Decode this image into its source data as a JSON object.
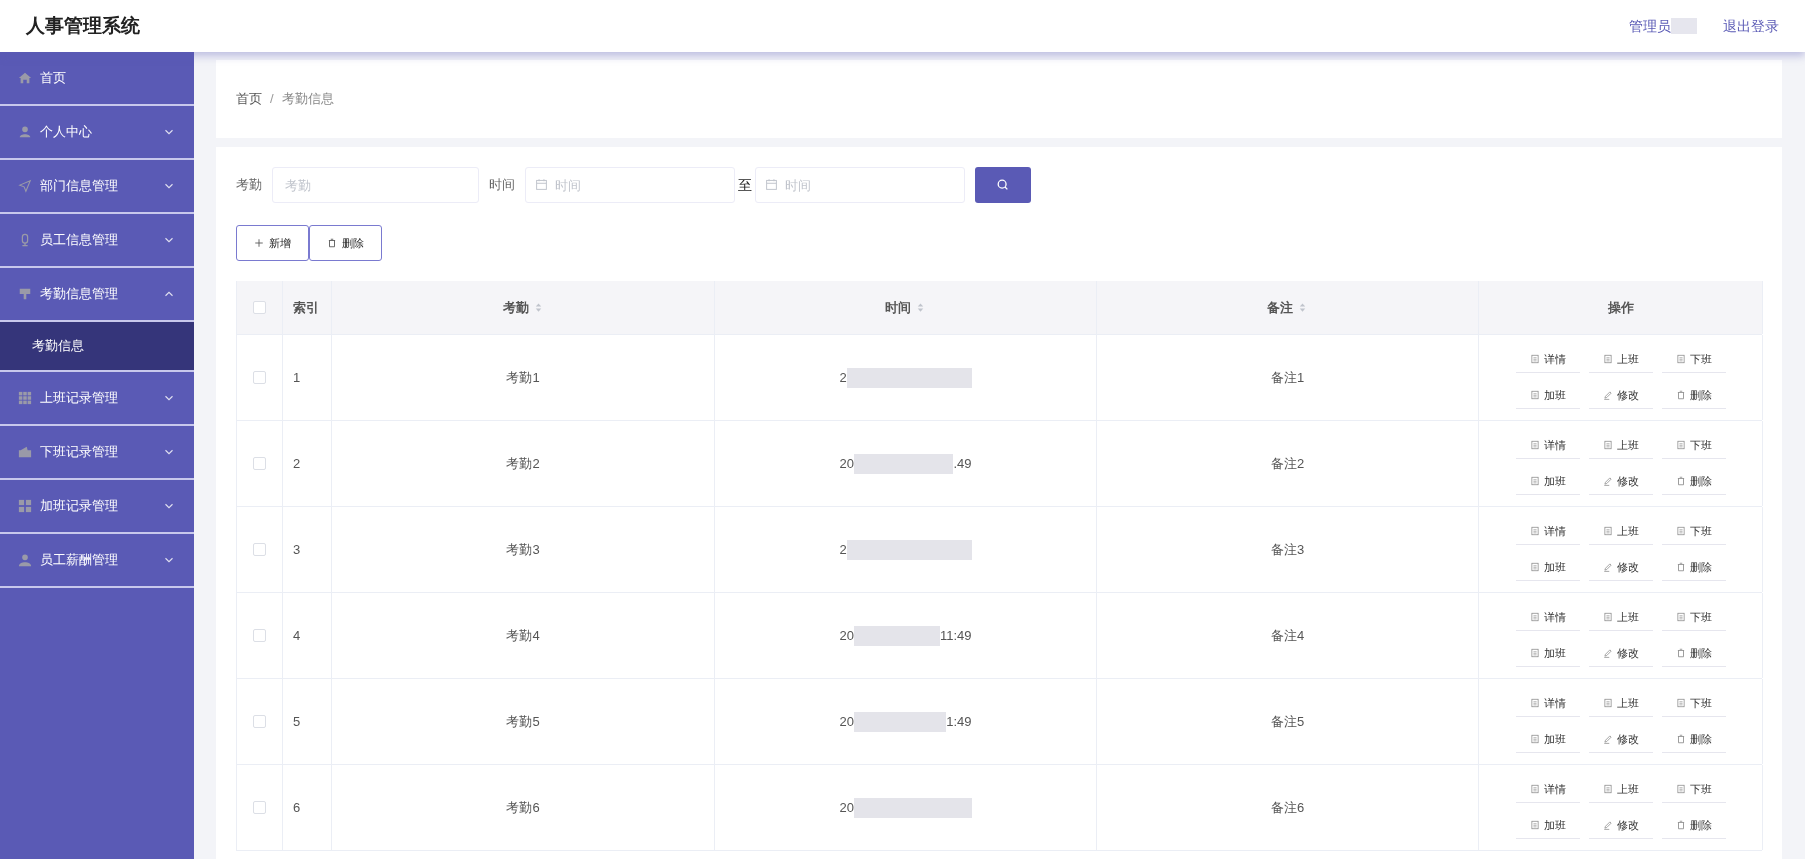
{
  "header": {
    "title": "人事管理系统",
    "user_label": "管理员",
    "logout": "退出登录"
  },
  "sidebar": {
    "items": [
      {
        "label": "首页",
        "selected": false
      },
      {
        "label": "个人中心",
        "expanded": false,
        "selected": false
      },
      {
        "label": "部门信息管理",
        "expanded": false,
        "selected": false
      },
      {
        "label": "员工信息管理",
        "expanded": false,
        "selected": false
      },
      {
        "label": "考勤信息管理",
        "expanded": true,
        "selected": false,
        "children": [
          {
            "label": "考勤信息",
            "selected": true
          }
        ]
      },
      {
        "label": "上班记录管理",
        "expanded": false,
        "selected": false
      },
      {
        "label": "下班记录管理",
        "expanded": false,
        "selected": false
      },
      {
        "label": "加班记录管理",
        "expanded": false,
        "selected": false
      },
      {
        "label": "员工薪酬管理",
        "expanded": false,
        "selected": false
      }
    ]
  },
  "breadcrumb": [
    "首页",
    "考勤信息"
  ],
  "breadcrumb_separator": "/",
  "search": {
    "fields": [
      {
        "label": "考勤",
        "placeholder": "考勤",
        "kind": "text"
      },
      {
        "label": "时间",
        "placeholder": "时间",
        "kind": "date"
      },
      {
        "label": "至",
        "placeholder": "时间",
        "kind": "date"
      }
    ]
  },
  "toolbar": [
    {
      "label": "新增",
      "kind": "add"
    },
    {
      "label": "删除",
      "kind": "delete"
    }
  ],
  "table": {
    "header_checked": false,
    "columns": [
      {
        "label": "索引",
        "sortable": false
      },
      {
        "label": "考勤",
        "sortable": true
      },
      {
        "label": "时间",
        "sortable": true
      },
      {
        "label": "备注",
        "sortable": true
      },
      {
        "label": "操作",
        "sortable": false
      }
    ],
    "rows": [
      {
        "checked": false,
        "index": "1",
        "attendance": "考勤1",
        "time_start": "2",
        "time_end": "",
        "note": "备注1",
        "actions": [
          "详情",
          "上班",
          "下班",
          "加班",
          "修改",
          "删除"
        ]
      },
      {
        "checked": false,
        "index": "2",
        "attendance": "考勤2",
        "time_start": "20",
        "time_end": ".49",
        "note": "备注2",
        "actions": [
          "详情",
          "上班",
          "下班",
          "加班",
          "修改",
          "删除"
        ]
      },
      {
        "checked": false,
        "index": "3",
        "attendance": "考勤3",
        "time_start": "2",
        "time_end": "",
        "note": "备注3",
        "actions": [
          "详情",
          "上班",
          "下班",
          "加班",
          "修改",
          "删除"
        ]
      },
      {
        "checked": false,
        "index": "4",
        "attendance": "考勤4",
        "time_start": "20",
        "time_end": "11:49",
        "note": "备注4",
        "actions": [
          "详情",
          "上班",
          "下班",
          "加班",
          "修改",
          "删除"
        ]
      },
      {
        "checked": false,
        "index": "5",
        "attendance": "考勤5",
        "time_start": "20",
        "time_end": "1:49",
        "note": "备注5",
        "actions": [
          "详情",
          "上班",
          "下班",
          "加班",
          "修改",
          "删除"
        ]
      },
      {
        "checked": false,
        "index": "6",
        "attendance": "考勤6",
        "time_start": "20",
        "time_end": "",
        "note": "备注6",
        "actions": [
          "详情",
          "上班",
          "下班",
          "加班",
          "修改",
          "删除"
        ]
      }
    ]
  }
}
